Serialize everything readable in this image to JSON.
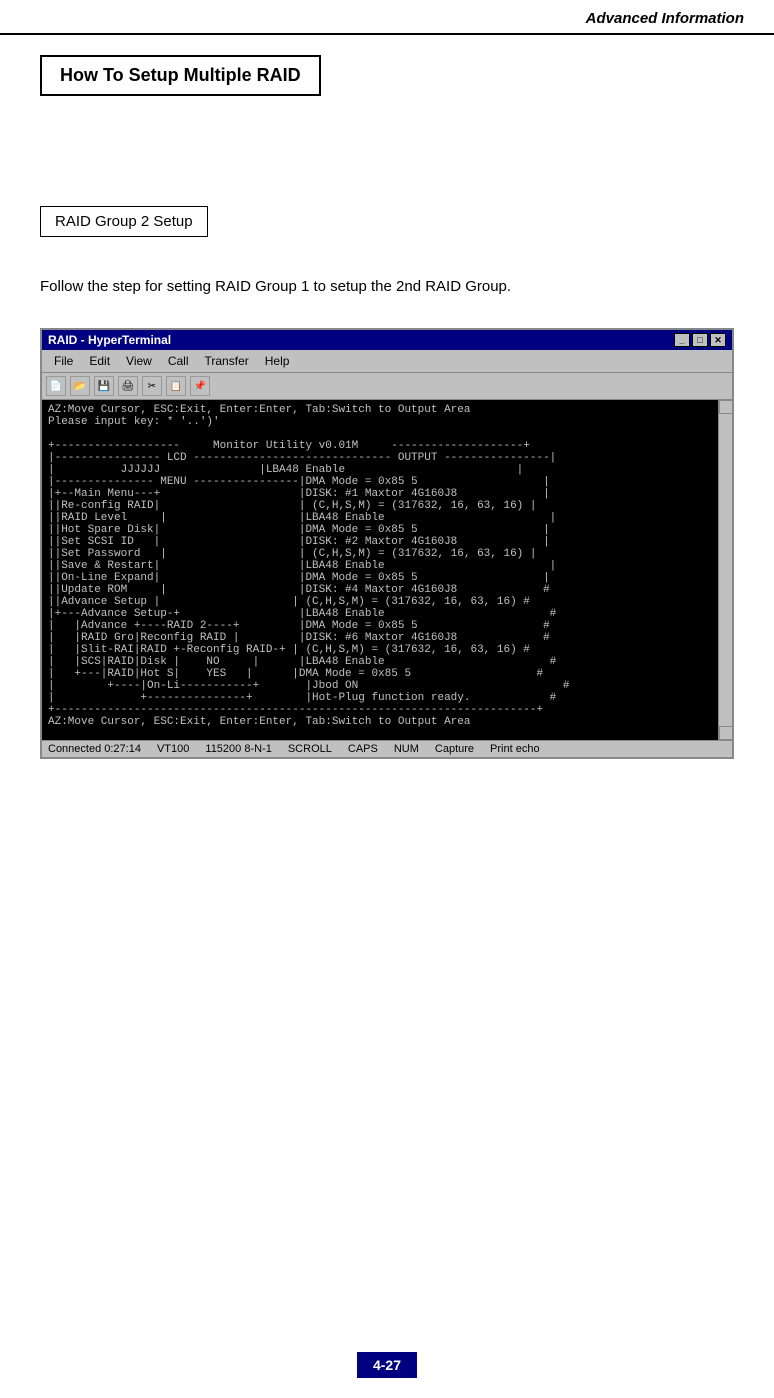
{
  "header": {
    "title": "Advanced Information"
  },
  "section": {
    "title": "How To Setup Multiple RAID",
    "subsection": "RAID Group 2 Setup",
    "body_text": "Follow the step for setting RAID Group 1 to setup the 2nd RAID Group."
  },
  "terminal": {
    "title": "RAID - HyperTerminal",
    "menu_items": [
      "File",
      "Edit",
      "View",
      "Call",
      "Transfer",
      "Help"
    ],
    "toolbar_icons": [
      "new",
      "open",
      "save",
      "print",
      "cut",
      "copy",
      "paste"
    ],
    "status_bar": {
      "connected": "Connected 0:27:14",
      "vt100": "VT100",
      "baud": "115200 8-N-1",
      "scroll": "SCROLL",
      "caps": "CAPS",
      "num": "NUM",
      "capture": "Capture",
      "print_echo": "Print echo"
    },
    "screen_lines": [
      "AZ:Move Cursor, ESC:Exit, Enter:Enter, Tab:Switch to Output Area",
      "Please input key: * '..')'",
      "",
      "+-------------------     Monitor Utility v0.01M      --------------------+",
      "|---------------- LCD ------------------------------ OUTPUT --------------|",
      "|          JJJJJJ              |LBA48 Enable                              |",
      "|--------------- MENU ----------------|DMA Mode = 0x85 5                  |",
      "|+--Main Menu---+                     |DISK: #1 Maxtor 4G160J8            |",
      "||Re-config RAID|                     | (C,H,S,M) = (317632, 16, 63, 16) |",
      "||RAID Level     |                    |LBA48 Enable                       |",
      "||Hot Spare Disk|                     |DMA Mode = 0x85 5                  |",
      "||Set SCSI ID   |                     |DISK: #2 Maxtor 4G160J8            |",
      "||Set Password   |                    | (C,H,S,M) = (317632, 16, 63, 16) |",
      "||Save & Restart|                     |LBA48 Enable                       |",
      "||On-Line Expand|                     |DMA Mode = 0x85 5                  |",
      "||Update ROM     |                    |DISK: #4 Maxtor 4G160J8            #",
      "||Advance Setup  |                    | (C,H,S,M) = (317632, 16, 63, 16) #",
      "|+---Advance Setup-+                  |LBA48 Enable                       #",
      "|   |Advance +----RAID 2----+         |DMA Mode = 0x85 5                  #",
      "|   |RAID Gro|Reconfig RAID |         |DISK: #6 Maxtor 4G160J8            #",
      "|   |Slit-RAI|RAID +-Reconfig RAID-+  | (C,H,S,M) = (317632, 16, 63, 16) #",
      "|   |SCS|RAID|Disk |    NO    |        |LBA48 Enable                       #",
      "|   +---|RAID|Hot S|    YES   |        |DMA Mode = 0x85 5                  #",
      "|       +----|On-Li-----------+        |Jbod ON                            #",
      "|            +---------------+         |Hot-Plug function ready.           #",
      "+-------------------------------------------------------------------------+",
      "AZ:Move Cursor, ESC:Exit, Enter:Enter, Tab:Switch to Output Area"
    ]
  },
  "page_number": "4-27"
}
